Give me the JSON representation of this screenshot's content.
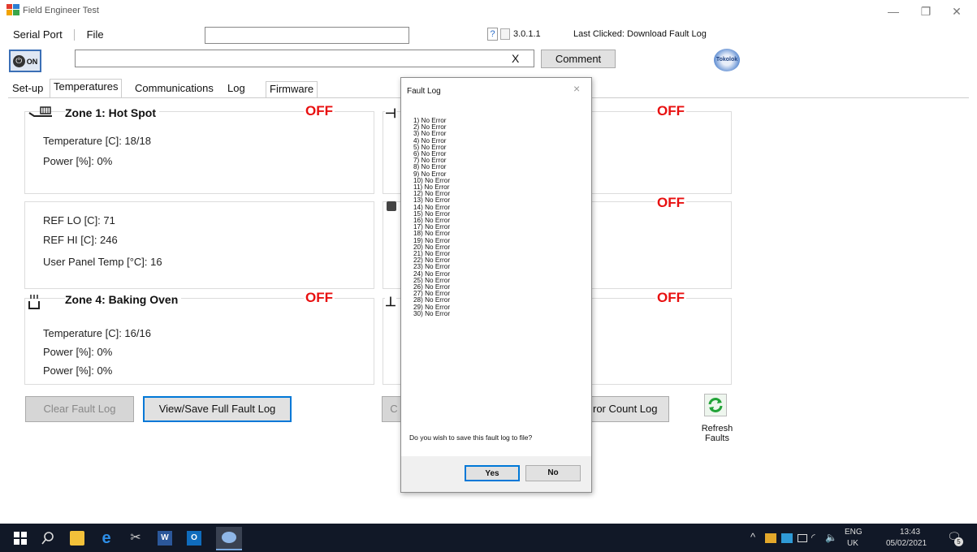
{
  "window": {
    "title": "Field Engineer Test"
  },
  "menu": {
    "serial_port": "Serial Port",
    "file": "File"
  },
  "toolbar": {
    "help": "?",
    "version": "3.0.1.1",
    "last_clicked": "Last Clicked: Download Fault Log",
    "power_label": "ON",
    "clear_x": "X",
    "comment_button": "Comment",
    "logo_text": "Tokolok"
  },
  "tabs": [
    "Set-up",
    "Temperatures",
    "Communications",
    "Log",
    "Firmware"
  ],
  "zones": {
    "zone1": {
      "title": "Zone 1: Hot Spot",
      "status": "OFF",
      "temperature": "Temperature [C]: 18/18",
      "power": "Power [%]: 0%"
    },
    "ref": {
      "ref_lo": "REF LO [C]: 71",
      "ref_hi": "REF HI [C]: 246",
      "panel_temp": "User Panel Temp [°C]: 16"
    },
    "zone4": {
      "title": "Zone 4: Baking Oven",
      "status": "OFF",
      "temperature": "Temperature [C]: 16/16",
      "power1": "Power [%]: 0%",
      "power2": "Power [%]: 0%"
    },
    "right_statuses": [
      "OFF",
      "OFF",
      "OFF"
    ]
  },
  "buttons": {
    "clear_fault_log": "Clear Fault Log",
    "view_save_fault_log": "View/Save Full Fault Log",
    "partial_c": "C",
    "error_count_log": "ror Count Log",
    "refresh_faults": "Refresh Faults"
  },
  "dialog": {
    "title": "Fault Log",
    "close": "×",
    "entries": [
      "1) No Error",
      "2) No Error",
      "3) No Error",
      "4) No Error",
      "5) No Error",
      "6) No Error",
      "7) No Error",
      "8) No Error",
      "9) No Error",
      "10) No Error",
      "11) No Error",
      "12) No Error",
      "13) No Error",
      "14) No Error",
      "15) No Error",
      "16) No Error",
      "17) No Error",
      "18) No Error",
      "19) No Error",
      "20) No Error",
      "21) No Error",
      "22) No Error",
      "23) No Error",
      "24) No Error",
      "25) No Error",
      "26) No Error",
      "27) No Error",
      "28) No Error",
      "29) No Error",
      "30) No Error"
    ],
    "question": "Do you wish to save this fault log to file?",
    "yes": "Yes",
    "no": "No"
  },
  "taskbar": {
    "language": "ENG",
    "region": "UK",
    "time": "13:43",
    "date": "05/02/2021",
    "notification_count": "5"
  },
  "colors": {
    "off_red": "#e81010",
    "taskbar": "#111827",
    "accent_blue": "#0078d7"
  }
}
